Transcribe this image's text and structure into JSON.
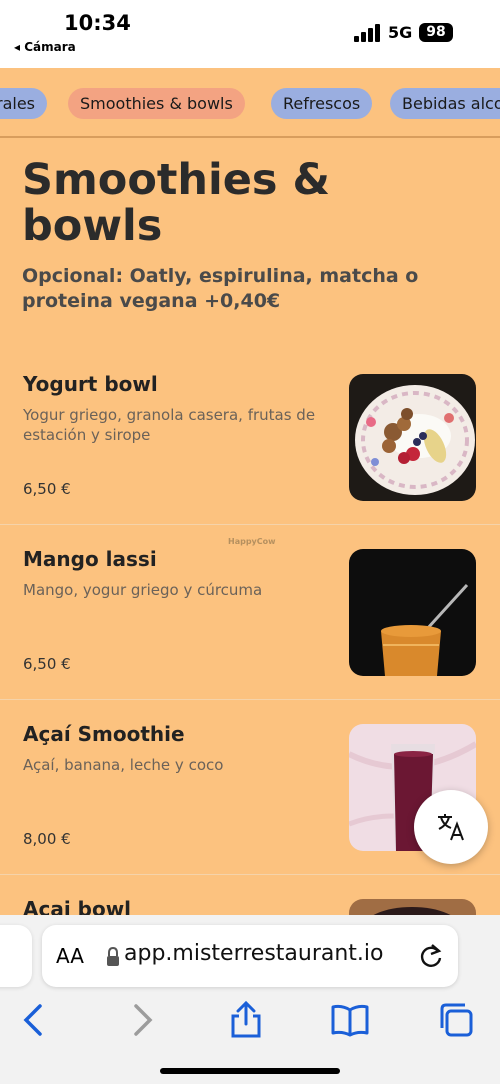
{
  "status_bar": {
    "time": "10:34",
    "back_label": "◂ Cámara",
    "network": "5G",
    "battery": "98"
  },
  "tabs": [
    {
      "label": "rales",
      "active": false
    },
    {
      "label": "Smoothies & bowls",
      "active": true
    },
    {
      "label": "Refrescos",
      "active": false
    },
    {
      "label": "Bebidas alco",
      "active": false
    }
  ],
  "section": {
    "title": "Smoothies & bowls",
    "subtitle": "Opcional: Oatly, espirulina, matcha o proteina vegana +0,40€"
  },
  "items": [
    {
      "name": "Yogurt bowl",
      "description": "Yogur griego, granola casera, frutas de estación y sirope",
      "price": "6,50 €",
      "image": "yogurt-bowl-photo"
    },
    {
      "name": "Mango lassi",
      "description": "Mango, yogur griego y cúrcuma",
      "price": "6,50 €",
      "image": "mango-lassi-photo"
    },
    {
      "name": "Açaí Smoothie",
      "description": "Açaí, banana, leche y coco",
      "price": "8,00 €",
      "image": "acai-smoothie-photo"
    },
    {
      "name": "Açai bowl",
      "description": "",
      "price": "",
      "image": "acai-bowl-photo"
    }
  ],
  "watermark": "HappyCow",
  "translate_button": {
    "icon": "translate-icon"
  },
  "browser": {
    "text_size_label": "AA",
    "url": "app.misterrestaurant.io",
    "icons": [
      "lock-icon",
      "reload-icon",
      "back-icon",
      "forward-icon",
      "share-icon",
      "bookmarks-icon",
      "tabs-icon"
    ]
  },
  "colors": {
    "page_bg": "#fcc27f",
    "tab_bg": "#9aaee0",
    "tab_active_bg": "#f3a382",
    "browser_accent": "#1a5fd8"
  }
}
